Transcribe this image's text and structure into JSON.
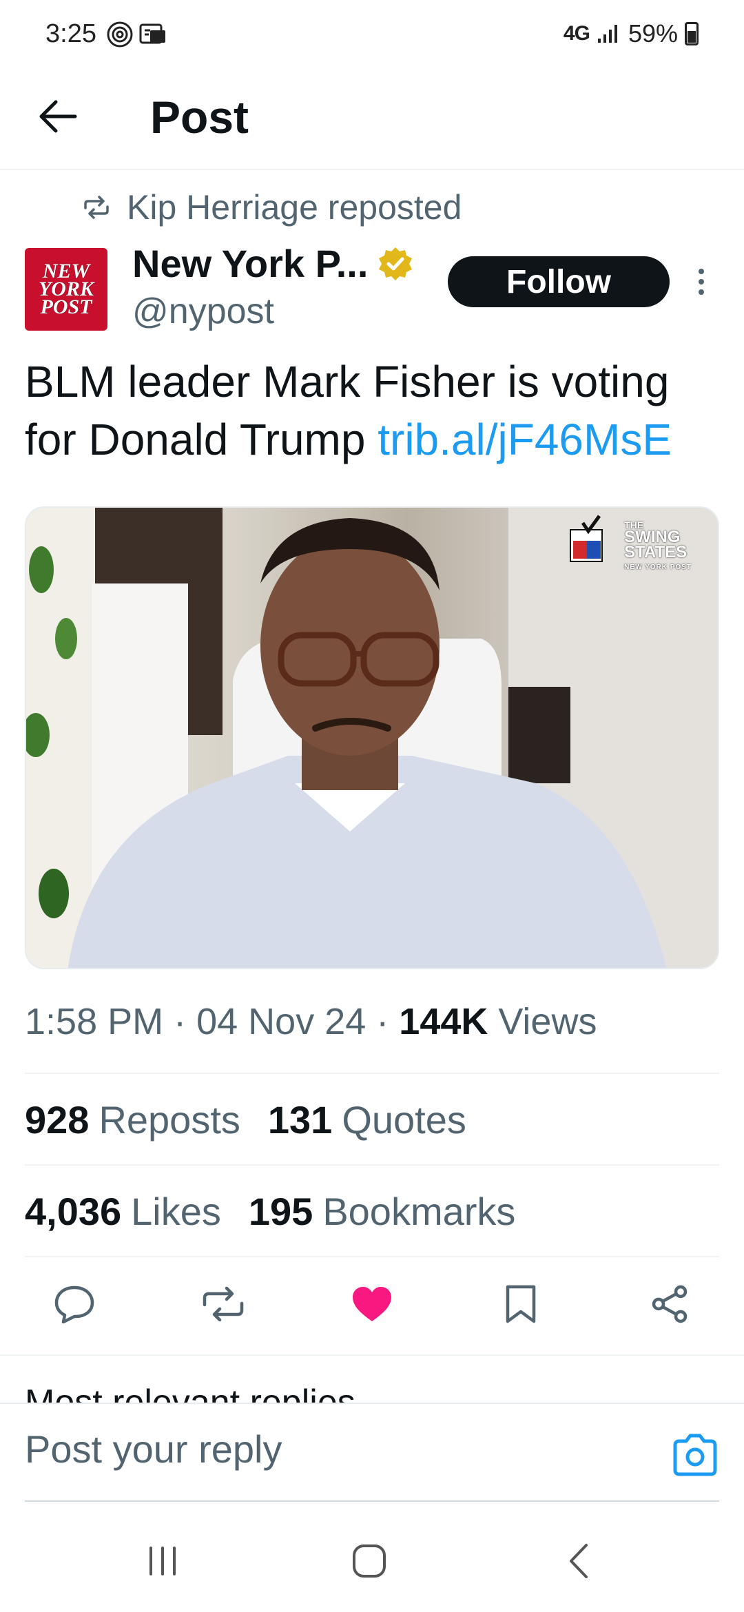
{
  "status_bar": {
    "time": "3:25",
    "network": "4G",
    "battery": "59%"
  },
  "header": {
    "title": "Post"
  },
  "repost": {
    "text": "Kip Herriage reposted"
  },
  "author": {
    "name": "New York P...",
    "handle": "@nypost",
    "avatar_lines": [
      "NEW",
      "YORK",
      "POST"
    ]
  },
  "follow_label": "Follow",
  "tweet": {
    "text": "BLM leader Mark Fisher is voting for Donald Trump ",
    "link": "trib.al/jF46MsE"
  },
  "media": {
    "badge_line1": "THE",
    "badge_line2": "SWING",
    "badge_line3": "STATES",
    "badge_sub": "NEW YORK POST"
  },
  "meta": {
    "time": "1:58 PM",
    "date": "04 Nov 24",
    "views_count": "144K",
    "views_label": "Views"
  },
  "stats": {
    "reposts_count": "928",
    "reposts_label": "Reposts",
    "quotes_count": "131",
    "quotes_label": "Quotes",
    "likes_count": "4,036",
    "likes_label": "Likes",
    "bookmarks_count": "195",
    "bookmarks_label": "Bookmarks"
  },
  "replies_sort": "Most relevant replies ⌄",
  "reply": {
    "placeholder": "Post your reply"
  },
  "colors": {
    "link": "#1d9bf0",
    "like": "#f91880",
    "verified": "#e2b719",
    "brand_red": "#c8102e"
  }
}
